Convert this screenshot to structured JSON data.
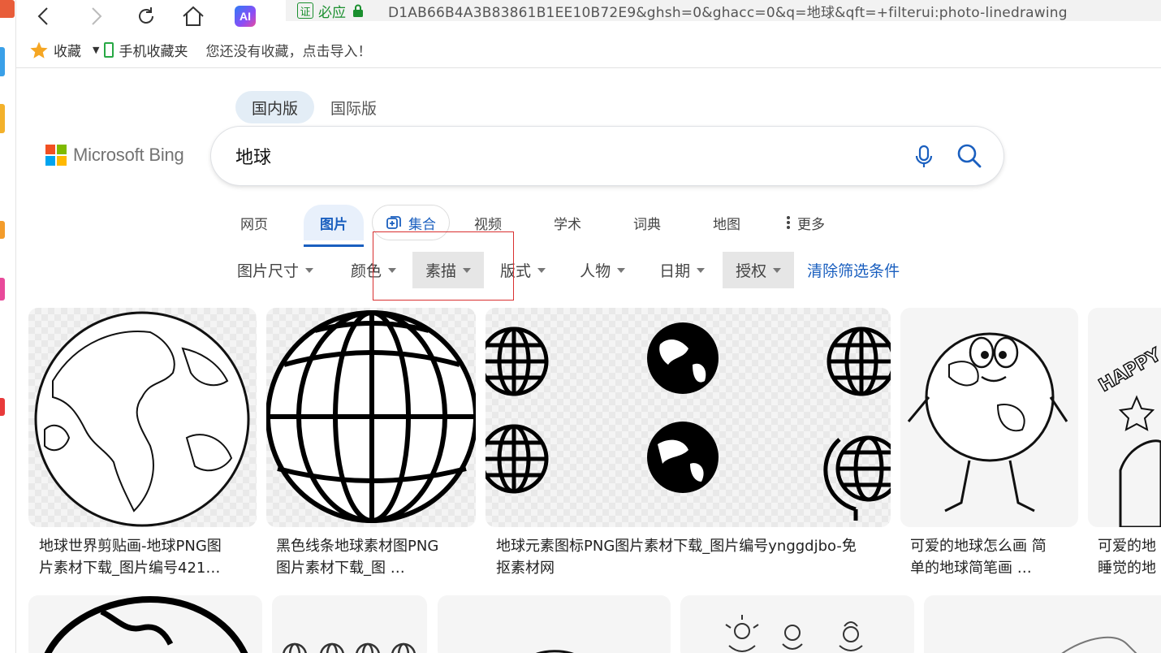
{
  "browser": {
    "cert_label": "证",
    "cert_text": "必应",
    "url": "D1AB66B4A3B83861B1EE10B72E9&ghsh=0&ghacc=0&q=地球&qft=+filterui:photo-linedrawing",
    "ai_label": "AI"
  },
  "bookmarks": {
    "favorites": "收藏",
    "mobile": "手机收藏夹",
    "hint": "您还没有收藏，点击导入！"
  },
  "bing": {
    "logo_text": "Microsoft Bing",
    "region_tabs": [
      "国内版",
      "国际版"
    ],
    "query": "地球",
    "scopes": {
      "web": "网页",
      "images": "图片",
      "collections": "集合",
      "videos": "视频",
      "academic": "学术",
      "dictionary": "词典",
      "maps": "地图",
      "more": "更多"
    },
    "filters": {
      "size": "图片尺寸",
      "color": "颜色",
      "type": "素描",
      "layout": "版式",
      "people": "人物",
      "date": "日期",
      "license": "授权",
      "clear": "清除筛选条件"
    }
  },
  "results": [
    {
      "line1": "地球世界剪贴画-地球PNG图",
      "line2": "片素材下载_图片编号421…"
    },
    {
      "line1": "黑色线条地球素材图PNG",
      "line2": "图片素材下载_图 …"
    },
    {
      "line1": "地球元素图标PNG图片素材下载_图片编号ynggdjbo-免",
      "line2": "抠素材网"
    },
    {
      "line1": "可爱的地球怎么画 简",
      "line2": "单的地球简笔画 …"
    },
    {
      "line1": "可爱的地",
      "line2": "睡觉的地"
    }
  ],
  "cartoon_text": "HAPPY E",
  "colors": {
    "accent": "#1a5fbf",
    "highlight_box": "#d93030",
    "ms_red": "#f25022",
    "ms_green": "#7fba00",
    "ms_blue": "#00a4ef",
    "ms_yellow": "#ffb900"
  }
}
